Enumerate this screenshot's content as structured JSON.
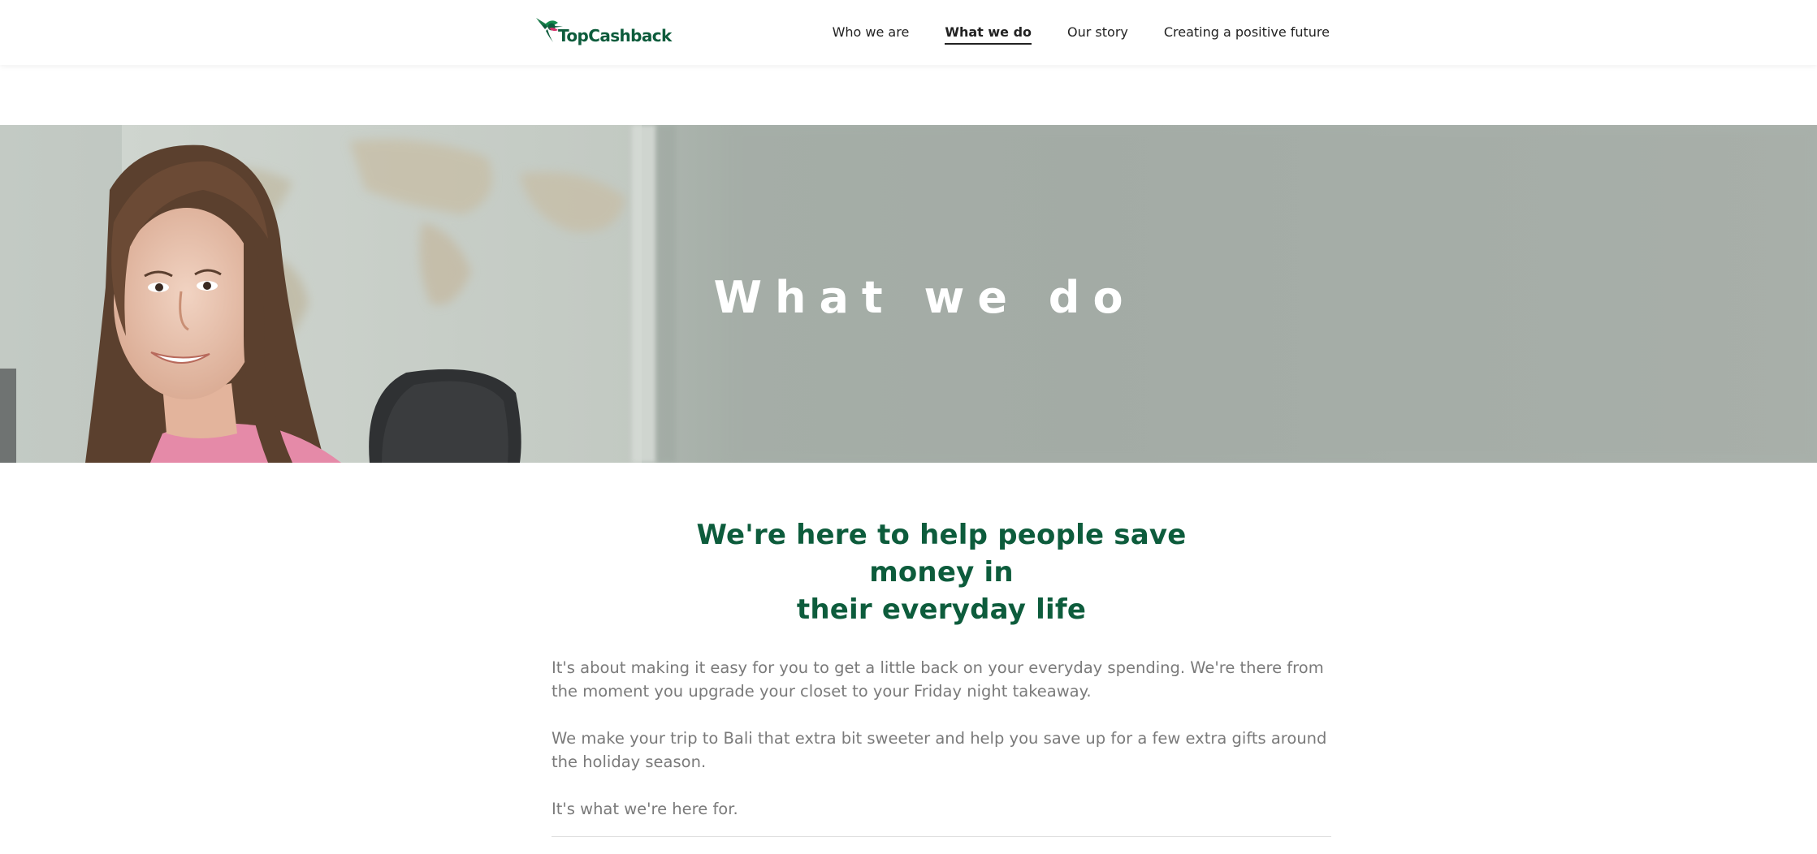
{
  "header": {
    "logo_text": "TopCashback",
    "nav": [
      {
        "label": "Who we are",
        "active": false
      },
      {
        "label": "What we do",
        "active": true
      },
      {
        "label": "Our story",
        "active": false
      },
      {
        "label": "Creating a positive future",
        "active": false
      }
    ]
  },
  "hero": {
    "title": "What we do"
  },
  "main": {
    "headline_line1": "We're here to help people save money in",
    "headline_line2": "their everyday life",
    "paragraphs": [
      "It's about making it easy for you to get a little back on your everyday spending. We're there from the moment you upgrade your closet to your Friday night takeaway.",
      "We make your trip to Bali that extra bit sweeter and help you save up for a few extra gifts around the holiday season.",
      "It's what we're here for."
    ]
  },
  "colors": {
    "brand_green": "#0d5c3c",
    "logo_pink": "#d6336c",
    "body_text": "#7a7a7a"
  },
  "icons": {
    "logo": "hummingbird-icon"
  }
}
